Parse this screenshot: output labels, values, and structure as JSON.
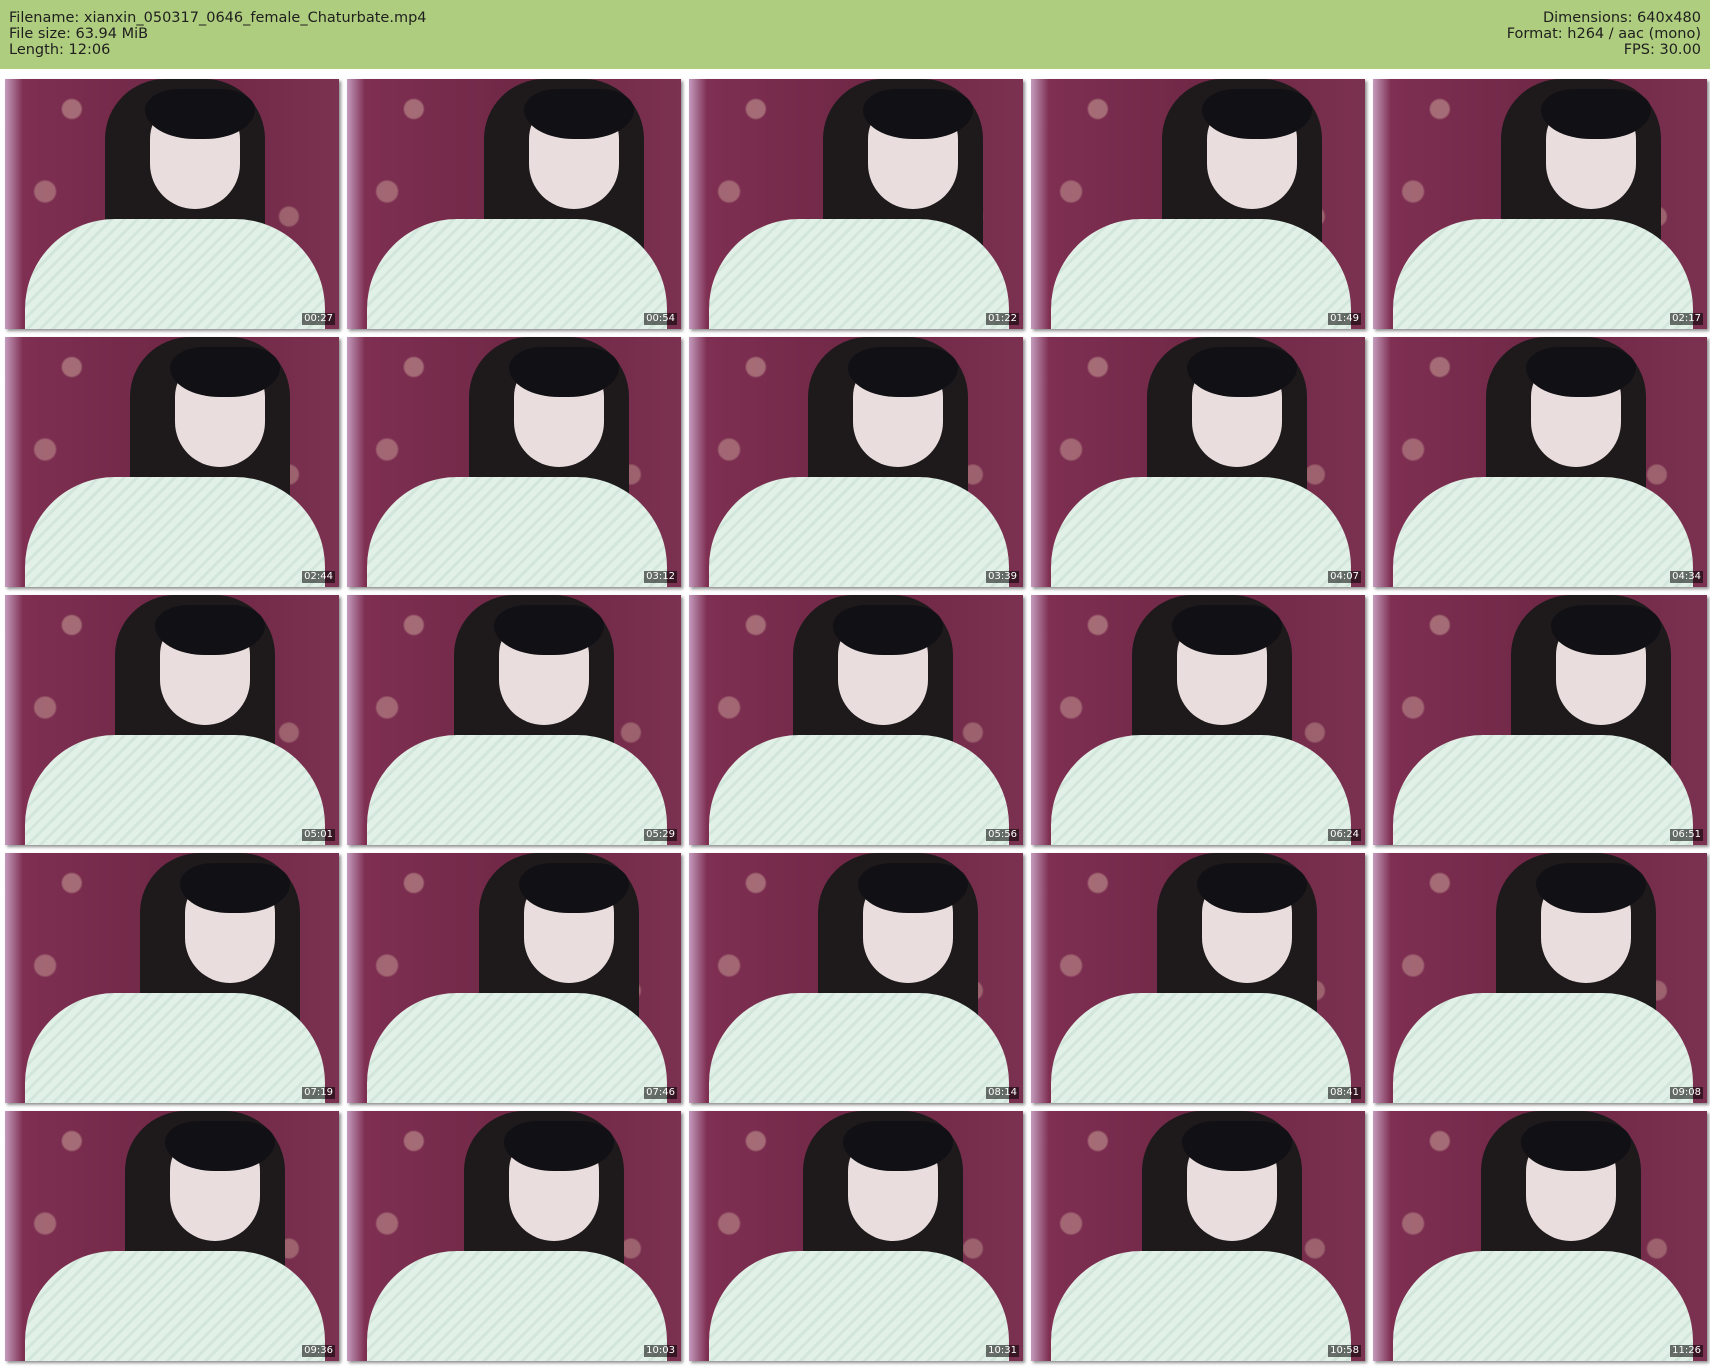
{
  "info": {
    "filename": "Filename: xianxin_050317_0646_female_Chaturbate.mp4",
    "filesize": "File size: 63.94 MiB",
    "length": "Length: 12:06",
    "dimensions": "Dimensions: 640x480",
    "format": "Format: h264 / aac (mono)",
    "fps": "FPS: 30.00"
  },
  "colors": {
    "header_bg": "#afcd7e",
    "background": "#ffffff"
  },
  "thumbnails": [
    "00:27",
    "00:54",
    "01:22",
    "01:49",
    "02:17",
    "02:44",
    "03:12",
    "03:39",
    "04:07",
    "04:34",
    "05:01",
    "05:29",
    "05:56",
    "06:24",
    "06:51",
    "07:19",
    "07:46",
    "08:14",
    "08:41",
    "09:08",
    "09:36",
    "10:03",
    "10:31",
    "10:58",
    "11:26"
  ]
}
